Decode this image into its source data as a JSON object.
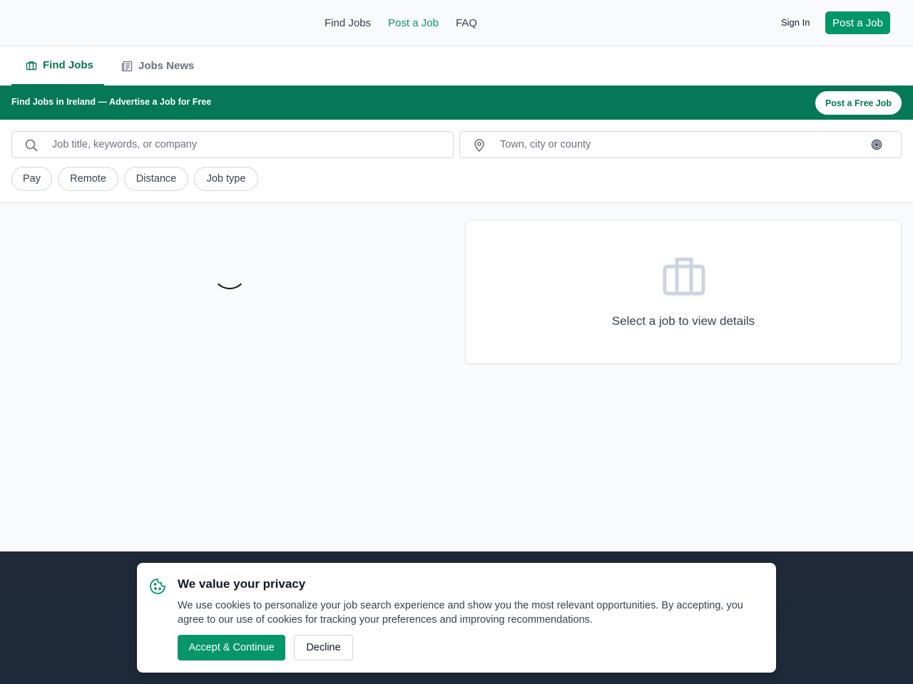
{
  "topnav": {
    "links": [
      "Find Jobs",
      "Post a Job",
      "FAQ"
    ],
    "active_link": "Post a Job",
    "sign_in": "Sign In",
    "post_job": "Post a Job"
  },
  "tabs": [
    {
      "label": "Find Jobs",
      "icon": "briefcase-icon",
      "active": true
    },
    {
      "label": "Jobs News",
      "icon": "newspaper-icon",
      "active": false
    }
  ],
  "banner": {
    "text": "Find Jobs in Ireland — Advertise a Job for Free",
    "button": "Post a Free Job"
  },
  "search": {
    "keywords_placeholder": "Job title, keywords, or company",
    "location_placeholder": "Town, city or county"
  },
  "filters": [
    "Pay",
    "Remote",
    "Distance",
    "Job type"
  ],
  "details": {
    "empty_message": "Select a job to view details"
  },
  "cookie": {
    "title": "We value your privacy",
    "body": "We use cookies to personalize your job search experience and show you the most relevant opportunities. By accepting, you agree to our use of cookies for tracking your preferences and improving recommendations.",
    "accept": "Accept & Continue",
    "decline": "Decline"
  },
  "colors": {
    "brand_green": "#059669",
    "banner_green": "#047857",
    "footer_dark": "#1f2937"
  }
}
